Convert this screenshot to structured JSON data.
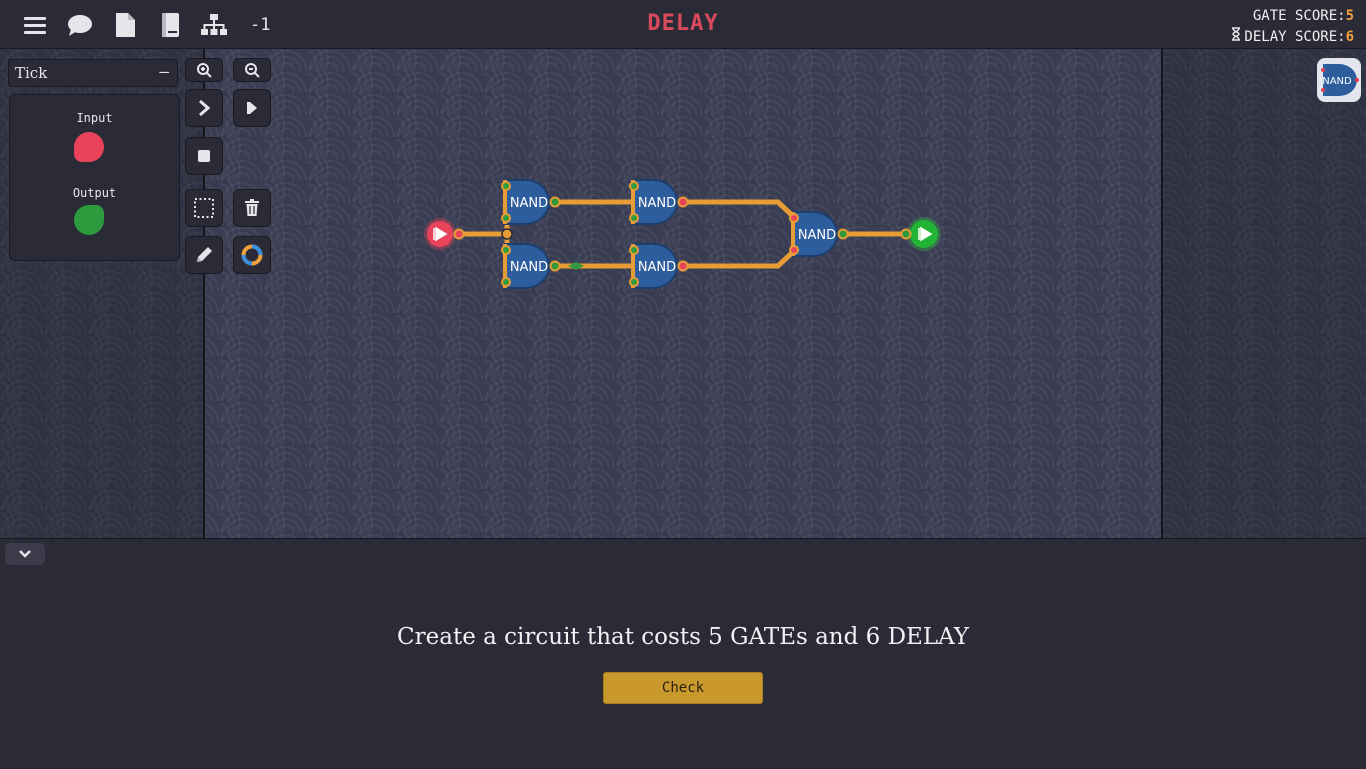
{
  "topbar": {
    "menu_icon": "menu-icon",
    "chat_icon": "chat-icon",
    "page_icon": "document-icon",
    "book_icon": "book-icon",
    "tree_icon": "hierarchy-icon",
    "tick_counter": "-1",
    "level_title": "DELAY",
    "gate_score_label": "GATE SCORE:",
    "gate_score_value": "5",
    "delay_score_label": "DELAY SCORE:",
    "delay_score_value": "6"
  },
  "left_panel": {
    "tick_select": "Tick",
    "tick_select_icon": "–",
    "input_label": "Input",
    "output_label": "Output",
    "colors": {
      "input": "#e8435a",
      "output": "#2e9a3e"
    }
  },
  "tools": {
    "zoom_in": "zoom-in-icon",
    "zoom_out": "zoom-out-icon",
    "step": "step-icon",
    "play": "play-icon",
    "stop": "stop-icon",
    "select": "selection-icon",
    "delete": "trash-icon",
    "pencil": "pencil-icon",
    "color_ring": "color-ring-icon"
  },
  "circuit": {
    "gate_label": "NAND",
    "gate_count": 5,
    "wire_color": "#f0a13b",
    "gate_color": "#2d5d9c"
  },
  "palette": {
    "gate_label": "NAND"
  },
  "bottom": {
    "objective": "Create a circuit that costs 5 GATEs and 6 DELAY",
    "check_label": "Check"
  }
}
